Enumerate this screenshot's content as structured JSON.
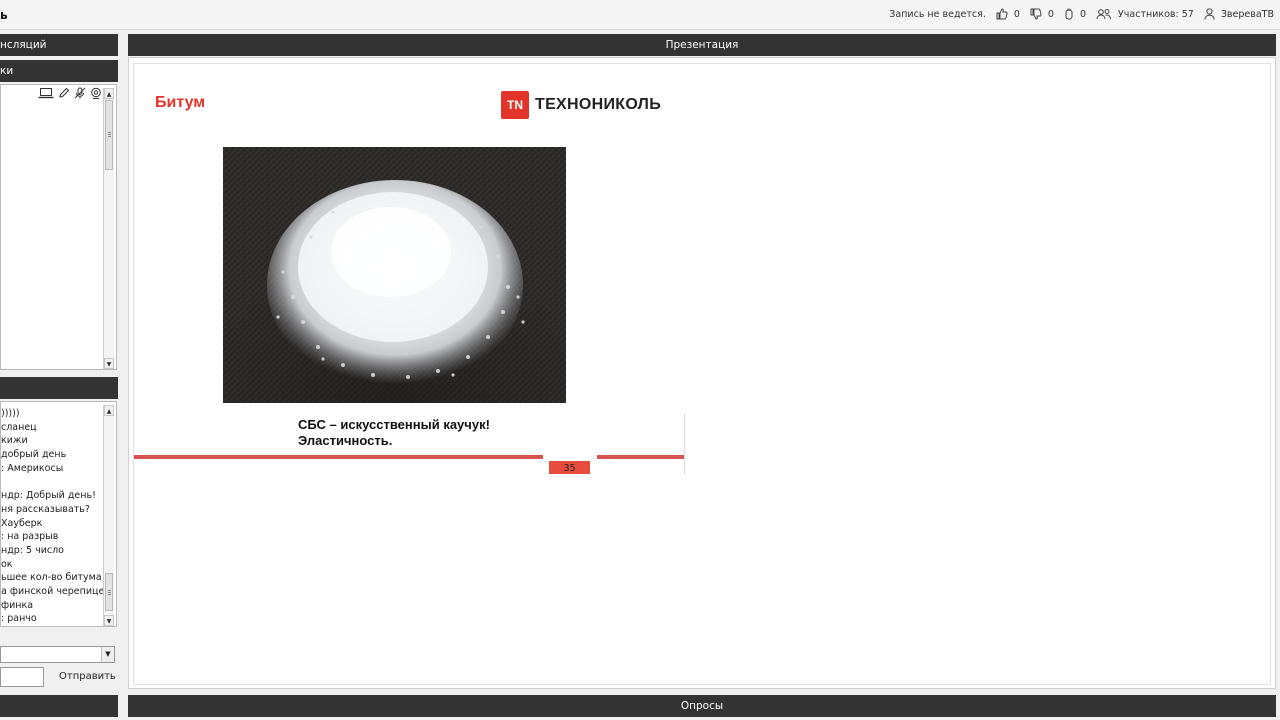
{
  "app": {
    "logo_text": "ь"
  },
  "topbar": {
    "recording": "Запись не ведется.",
    "likes": "0",
    "dislikes": "0",
    "hands": "0",
    "participants": "Участников:  57",
    "user": "ЗвереваТВ"
  },
  "left": {
    "broadcasts_header": "нсляций",
    "speakers_header": "ки",
    "chat_header": "",
    "chat_messages": [
      ")))))",
      "сланец",
      "кижи",
      "добрый день",
      ": Америкосы",
      "",
      "ндр: Добрый день!",
      "ня рассказывать?",
      "Хауберк",
      ": на разрыв",
      "ндр: 5 число",
      "ок",
      "ьшее кол-во битума",
      "а финской черепице?",
      "финка",
      ": ранчо"
    ],
    "send_label": "Отправить",
    "bottom_header": ""
  },
  "presentation": {
    "header": "Презентация",
    "slide_title": "Битум",
    "brand_mark": "TN",
    "brand_name": "ТЕХНОНИКОЛЬ",
    "caption_line1": "СБС – искусственный каучук!",
    "caption_line2": "Эластичность.",
    "page_number": "35"
  },
  "polls": {
    "header": "Опросы"
  },
  "colors": {
    "accent": "#e2342b",
    "header_bg": "#333333"
  }
}
